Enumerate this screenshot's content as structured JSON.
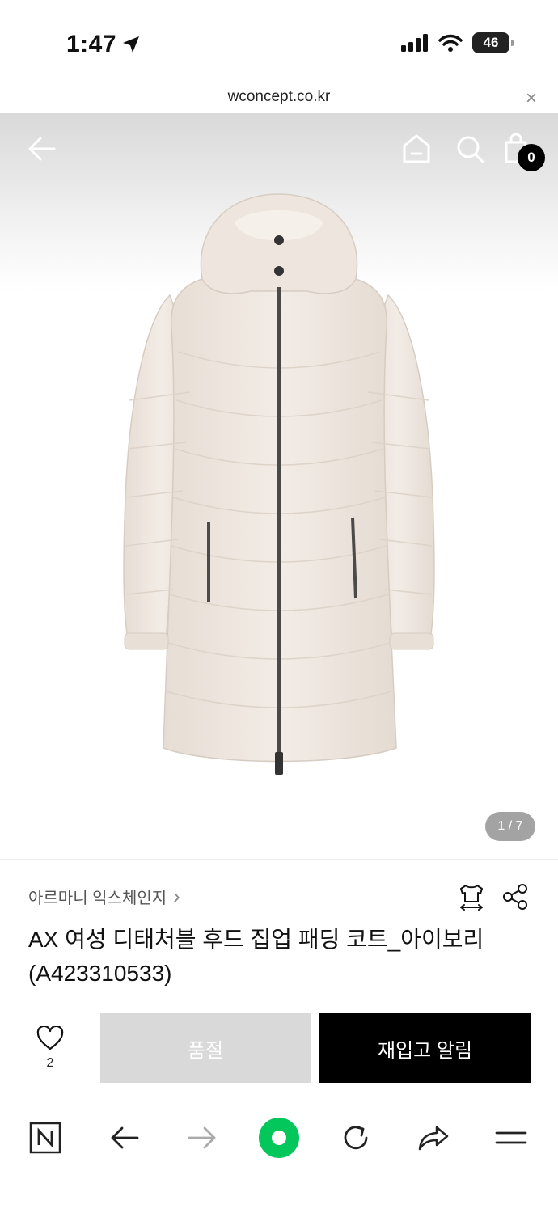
{
  "status": {
    "time": "1:47",
    "battery": "46"
  },
  "browser": {
    "url": "wconcept.co.kr",
    "close_glyph": "×"
  },
  "header": {
    "cart_count": "0"
  },
  "gallery": {
    "counter": "1 / 7"
  },
  "product": {
    "brand": "아르마니 익스체인지",
    "brand_chevron": "›",
    "title": "AX 여성 디태처블 후드 집업 패딩 코트_아이보리 (A423310533)"
  },
  "actions": {
    "like_count": "2",
    "soldout_label": "품절",
    "restock_label": "재입고 알림"
  },
  "colors": {
    "accent": "#000000",
    "ivory": "#efe8e1",
    "disabled": "#d9d9d9",
    "naver_green": "#03c75a"
  },
  "icons": [
    "location-arrow-icon",
    "signal-icon",
    "wifi-icon",
    "back-arrow-icon",
    "home-icon",
    "search-icon",
    "cart-icon",
    "size-guide-icon",
    "share-icon",
    "heart-icon",
    "naver-n-icon",
    "browser-back-icon",
    "browser-forward-icon",
    "green-dot-icon",
    "refresh-icon",
    "browser-share-icon",
    "menu-icon"
  ]
}
